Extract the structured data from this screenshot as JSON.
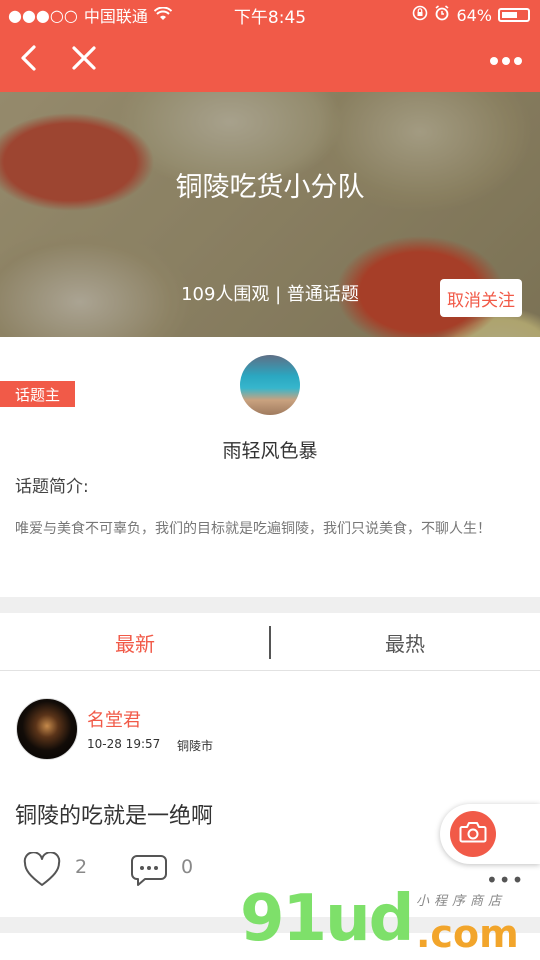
{
  "status_bar": {
    "signal": "●●●○○",
    "carrier": "中国联通",
    "time": "下午8:45",
    "battery_percent": "64%",
    "battery_level": 0.64
  },
  "nav": {
    "back_icon": "chevron-left-icon",
    "close_icon": "close-icon",
    "more_icon": "more-dots-icon"
  },
  "topic": {
    "title": "铜陵吃货小分队",
    "meta": "109人围观 | 普通话题",
    "unfollow_label": "取消关注"
  },
  "owner": {
    "tag": "话题主",
    "name": "雨轻风色暴"
  },
  "intro": {
    "label": "话题简介:",
    "text": "唯爱与美食不可辜负，我们的目标就是吃遍铜陵，我们只说美食，不聊人生！"
  },
  "tabs": [
    {
      "label": "最新",
      "active": true
    },
    {
      "label": "最热",
      "active": false
    }
  ],
  "post": {
    "author": "名堂君",
    "time": "10-28 19:57",
    "city": "铜陵市",
    "content": "铜陵的吃就是一绝啊",
    "likes": "2",
    "comments": "0",
    "more": "•••"
  },
  "watermark": {
    "main": "91ud",
    "domain": ".com",
    "tagline": "小程序商店"
  },
  "colors": {
    "accent": "#f15a48",
    "divider": "#efefef"
  }
}
